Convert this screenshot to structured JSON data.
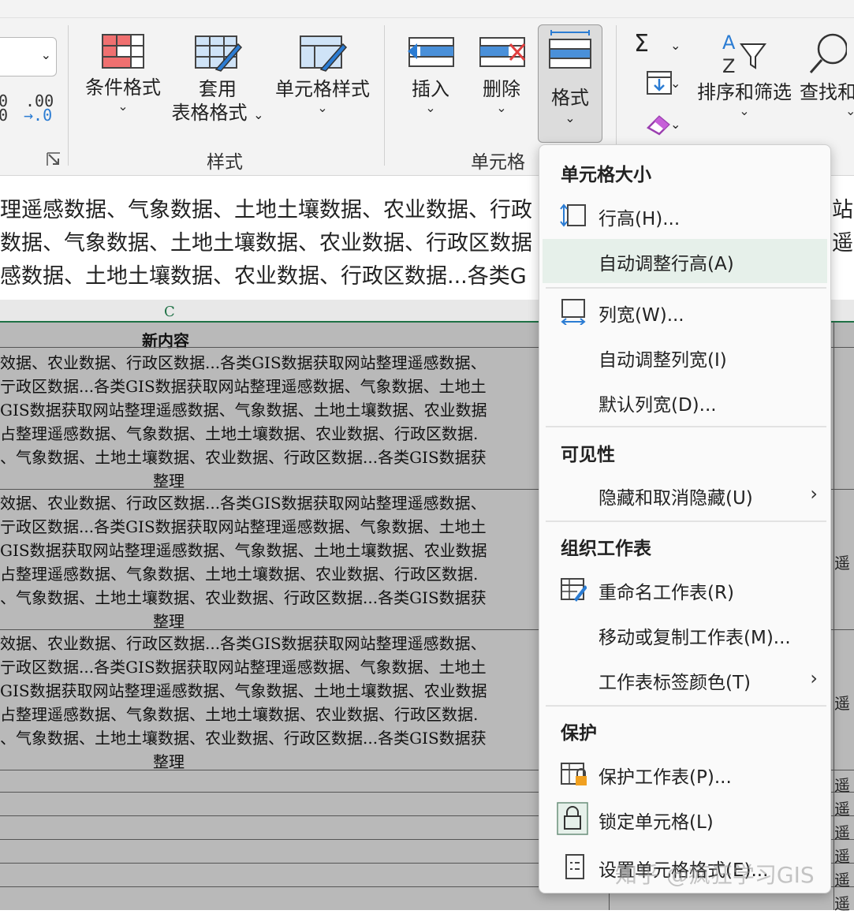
{
  "ribbon": {
    "styles": {
      "conditional_format": "条件格式",
      "table_format_line1": "套用",
      "table_format_line2": "表格格式",
      "cell_styles": "单元格样式",
      "group_label": "样式"
    },
    "cells": {
      "insert": "插入",
      "delete": "删除",
      "format": "格式",
      "group_label": "单元格"
    },
    "editing": {
      "sort_filter": "排序和筛选",
      "find_select": "查找和",
      "sum_symbol": "Σ"
    },
    "number": {
      "inc_decimal_top": "0",
      "inc_decimal_bottom": "0",
      "dec_decimal_top": ".00",
      "dec_decimal_bottom": "→.0"
    },
    "chevron": "⌄"
  },
  "formula_area": {
    "lines": [
      "理遥感数据、气象数据、土地土壤数据、农业数据、行政",
      "数据、气象数据、土地土壤数据、农业数据、行政区数据",
      "感数据、土地土壤数据、农业数据、行政区数据...各类G"
    ],
    "right_fragments": [
      "站",
      "遥",
      ""
    ]
  },
  "sheet": {
    "column_letter": "C",
    "header_cell": "新内容",
    "block_lines": [
      "效据、农业数据、行政区数据...各类GIS数据获取网站整理遥感数据、",
      "亍政区数据...各类GIS数据获取网站整理遥感数据、气象数据、土地土",
      "GIS数据获取网站整理遥感数据、气象数据、土地土壤数据、农业数据",
      "占整理遥感数据、气象数据、土地土壤数据、农业数据、行政区数据.",
      "、气象数据、土地土壤数据、农业数据、行政区数据...各类GIS数据获"
    ],
    "block_tail": "整理",
    "right_col": [
      "遥",
      "遥",
      "遥",
      "遥",
      "遥",
      "遥",
      "遥",
      "遥"
    ]
  },
  "menu": {
    "section_size": "单元格大小",
    "row_height": "行高(H)...",
    "autofit_row": "自动调整行高(A)",
    "col_width": "列宽(W)...",
    "autofit_col": "自动调整列宽(I)",
    "default_width": "默认列宽(D)...",
    "section_visibility": "可见性",
    "hide_unhide": "隐藏和取消隐藏(U)",
    "section_organize": "组织工作表",
    "rename_sheet": "重命名工作表(R)",
    "move_copy_sheet": "移动或复制工作表(M)...",
    "tab_color": "工作表标签颜色(T)",
    "section_protect": "保护",
    "protect_sheet": "保护工作表(P)...",
    "lock_cell": "锁定单元格(L)",
    "format_cells": "设置单元格格式(E)...",
    "submenu_arrow": "›"
  },
  "watermark": "知乎 @疯狂学习GIS",
  "colors": {
    "accent_green": "#1e7145",
    "highlight": "#e6f0ea",
    "sheet_selection_gray": "#b9b9b9",
    "icon_blue": "#2b7cd3",
    "icon_red": "#e04040"
  }
}
